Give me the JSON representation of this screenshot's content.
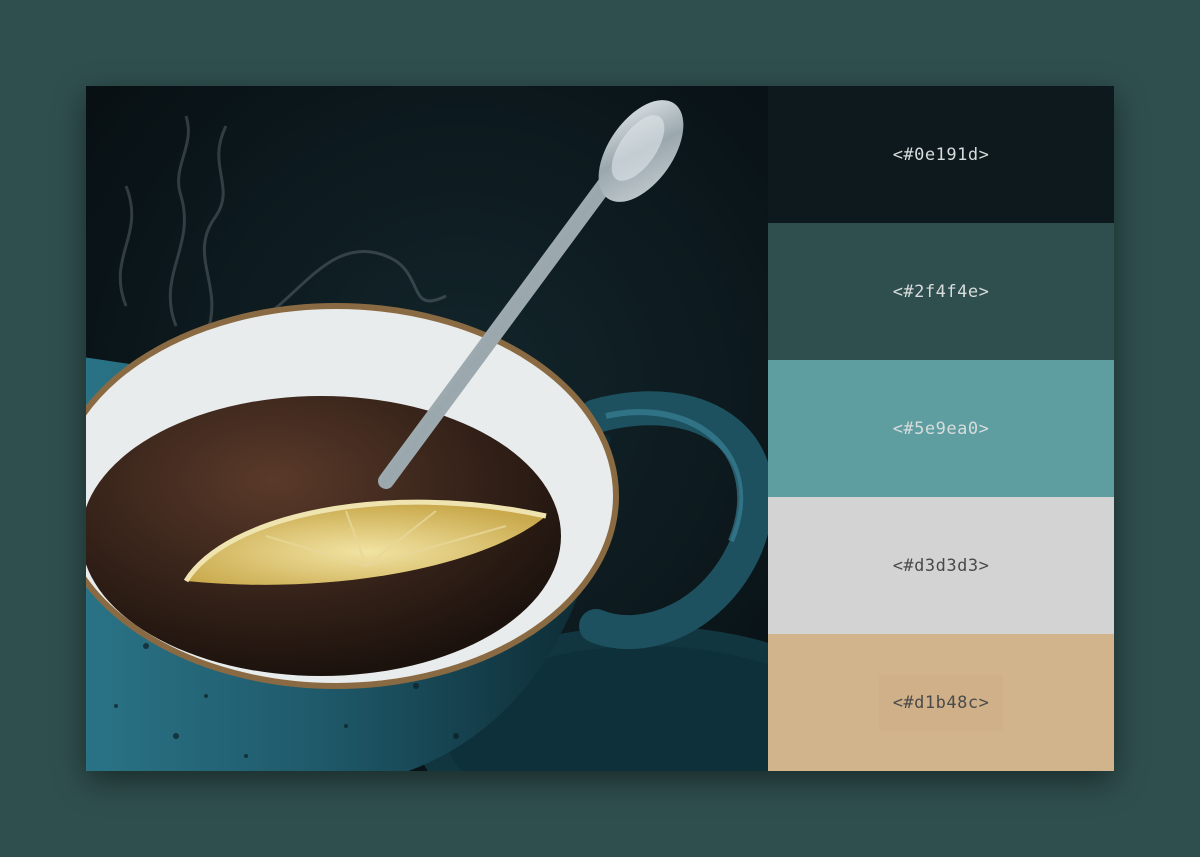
{
  "palette": {
    "swatches": [
      {
        "hex": "#0e191d",
        "label": "<#0e191d>",
        "text_tone": "light"
      },
      {
        "hex": "#2f4f4e",
        "label": "<#2f4f4e>",
        "text_tone": "light"
      },
      {
        "hex": "#5e9ea0",
        "label": "<#5e9ea0>",
        "text_tone": "light"
      },
      {
        "hex": "#d3d3d3",
        "label": "<#d3d3d3>",
        "text_tone": "dark"
      },
      {
        "hex": "#d1b48c",
        "label": "<#d1b48c>",
        "text_tone": "dark"
      }
    ]
  },
  "colors": {
    "page_background": "#2f4f4e",
    "photo_background": "#0e191d",
    "cup": "#1f5665",
    "tea": "#3a2a22",
    "lemon": "#d7c06a",
    "spoon": "#b9c3c8"
  }
}
